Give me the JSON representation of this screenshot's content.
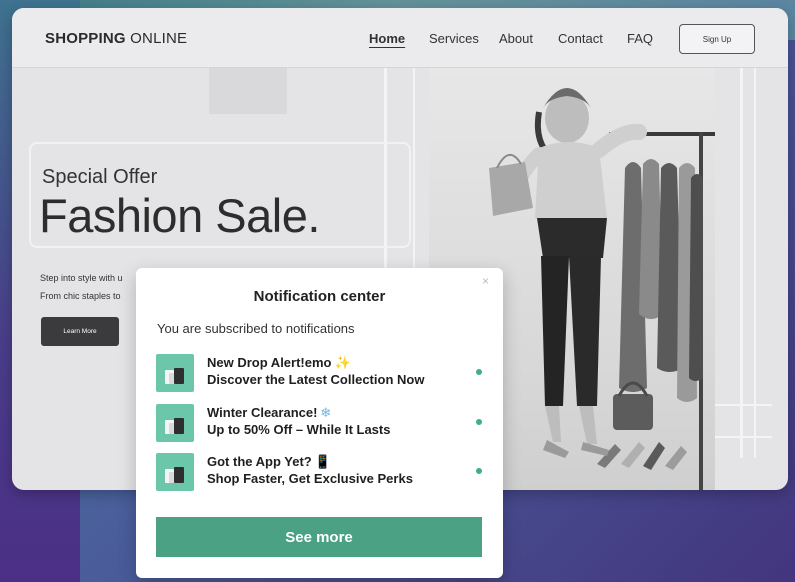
{
  "site": {
    "logo_bold": "SHOPPING",
    "logo_rest": " ONLINE",
    "nav": [
      "Home",
      "Services",
      "About",
      "Contact",
      "FAQ"
    ],
    "signup_label": "Sign Up"
  },
  "hero": {
    "kicker": "Special Offer",
    "title": "Fashion Sale.",
    "text_line1": "Step into style with u",
    "text_line2": "From chic staples to",
    "learn_more_label": "Learn More"
  },
  "notification_center": {
    "close_glyph": "×",
    "title": "Notification center",
    "subtitle": "You are subscribed to notifications",
    "items": [
      {
        "line1": "New Drop Alert!emo",
        "emoji": "✨",
        "line2": "Discover the Latest Collection Now"
      },
      {
        "line1": "Winter Clearance!",
        "emoji": "❄",
        "line2": "Up to 50% Off – While It Lasts"
      },
      {
        "line1": "Got the App Yet?",
        "emoji": "📱",
        "line2": "Shop Faster, Get Exclusive Perks"
      }
    ],
    "see_more_label": "See more"
  },
  "colors": {
    "accent_green": "#4aa183",
    "thumb_green": "#6cc6a9",
    "unread_dot": "#3fae8a"
  }
}
